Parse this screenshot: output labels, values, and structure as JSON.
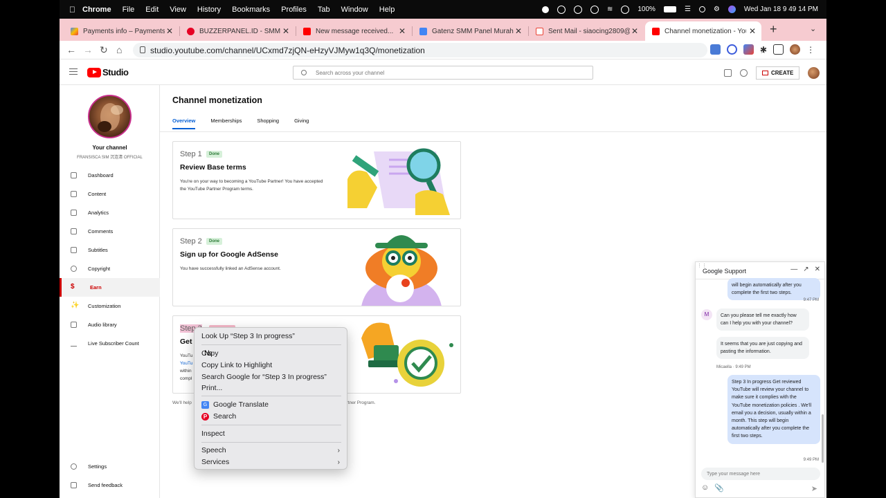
{
  "menubar": {
    "app": "Chrome",
    "menus": [
      "File",
      "Edit",
      "View",
      "History",
      "Bookmarks",
      "Profiles",
      "Tab",
      "Window",
      "Help"
    ],
    "battery": "100%",
    "datetime": "Wed Jan 18  9 49 14 PM"
  },
  "tabs": [
    {
      "label": "Payments info – Payments –",
      "color": "#fbbc04"
    },
    {
      "label": "BUZZERPANEL.ID - SMM Pa",
      "color": "#e60023"
    },
    {
      "label": "New message received...",
      "color": "#ff0000"
    },
    {
      "label": "Gatenz SMM Panel Murah | S",
      "color": "#4285f4"
    },
    {
      "label": "Sent Mail - siaocing2809@g",
      "color": "#ea4335"
    },
    {
      "label": "Channel monetization - You",
      "color": "#ff0000"
    }
  ],
  "address": {
    "url": "studio.youtube.com/channel/UCxmd7zjQN-eHzyVJMyw1q3Q/monetization"
  },
  "header": {
    "brand": "Studio",
    "search_placeholder": "Search across your channel",
    "create_label": "CREATE"
  },
  "sidebar": {
    "channel_title": "Your channel",
    "channel_name": "FRANSISCA SIM 沉连清 OFFICIAL",
    "items": [
      {
        "label": "Dashboard",
        "icon": "dashboard-icon"
      },
      {
        "label": "Content",
        "icon": "content-icon"
      },
      {
        "label": "Analytics",
        "icon": "analytics-icon"
      },
      {
        "label": "Comments",
        "icon": "comments-icon"
      },
      {
        "label": "Subtitles",
        "icon": "subtitles-icon"
      },
      {
        "label": "Copyright",
        "icon": "copyright-icon"
      },
      {
        "label": "Earn",
        "icon": "dollar-icon"
      },
      {
        "label": "Customization",
        "icon": "customization-icon"
      },
      {
        "label": "Audio library",
        "icon": "audio-library-icon"
      },
      {
        "label": "Live Subscriber Count",
        "icon": "live-count-icon"
      }
    ],
    "settings_label": "Settings",
    "feedback_label": "Send feedback"
  },
  "main": {
    "title": "Channel monetization",
    "tabs": [
      "Overview",
      "Memberships",
      "Shopping",
      "Giving"
    ],
    "steps": [
      {
        "step": "Step 1",
        "badge": "Done",
        "title": "Review Base terms",
        "desc": "You're on your way to becoming a YouTube Partner! You have accepted the YouTube Partner Program terms."
      },
      {
        "step": "Step 2",
        "badge": "Done",
        "title": "Sign up for Google AdSense",
        "desc": "You have successfully linked an AdSense account."
      },
      {
        "step": "Step 3",
        "title": "Get",
        "desc_fragments": [
          "YouTu",
          "YouTu",
          "within",
          "compl"
        ]
      }
    ],
    "footnote_left": "We'll help",
    "footnote_right": "artner Program."
  },
  "context_menu": {
    "items": [
      "Look Up “Step 3 In progress”",
      "Copy",
      "Copy Link to Highlight",
      "Search Google for “Step 3 In progress”",
      "Print...",
      "Google Translate",
      "Search",
      "Inspect",
      "Speech",
      "Services"
    ]
  },
  "chat": {
    "title": "Google Support",
    "messages": [
      {
        "from": "agent",
        "text": "will begin automatically after you complete the first two steps.",
        "time": "9:47 PM"
      },
      {
        "from": "user",
        "text": "Can you please tell me exactly how can I help you with your channel?"
      },
      {
        "from": "user",
        "text": "It seems that you are just copying and pasting the information.",
        "time": "Micaella · 9:49 PM"
      },
      {
        "from": "agent",
        "text": "Step 3 In progress Get reviewed YouTube will review your channel to make sure it complies with the YouTube monetization policies . We'll email you a decision, usually within a month. This step will begin automatically after you complete the first two steps.",
        "time": "9:49 PM"
      }
    ],
    "avatar_letter": "M",
    "input_placeholder": "Type your message here"
  }
}
